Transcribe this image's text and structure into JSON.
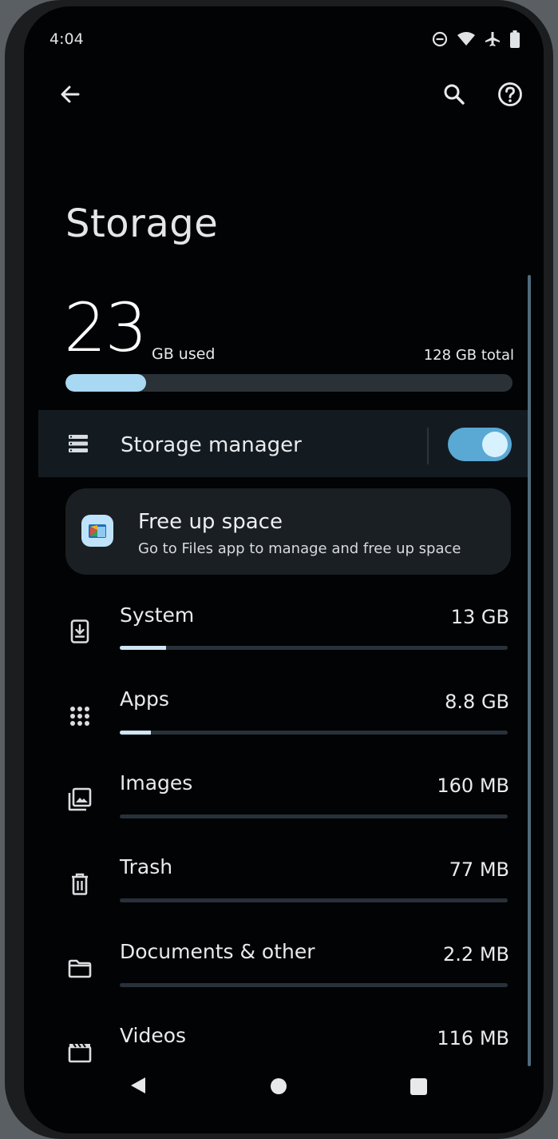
{
  "status_bar": {
    "time": "4:04",
    "icons": [
      "do-not-disturb-icon",
      "wifi-icon",
      "airplane-icon",
      "battery-icon"
    ]
  },
  "app_bar": {
    "back_icon": "arrow-left-icon",
    "actions": [
      "search-icon",
      "help-icon"
    ]
  },
  "page": {
    "title": "Storage"
  },
  "usage": {
    "used_value": "23",
    "used_label": "GB used",
    "total_label": "128 GB total",
    "used_fraction": 0.18
  },
  "storage_manager": {
    "label": "Storage manager",
    "enabled": true,
    "icon": "storage-list-icon"
  },
  "free_up": {
    "title": "Free up space",
    "subtitle": "Go to Files app to manage and free up space",
    "icon": "files-app-icon"
  },
  "categories": [
    {
      "name": "System",
      "size": "13 GB",
      "fraction": 0.12,
      "icon": "system-update-icon"
    },
    {
      "name": "Apps",
      "size": "8.8 GB",
      "fraction": 0.08,
      "icon": "apps-grid-icon"
    },
    {
      "name": "Images",
      "size": "160 MB",
      "fraction": 0.0,
      "icon": "image-gallery-icon"
    },
    {
      "name": "Trash",
      "size": "77 MB",
      "fraction": 0.0,
      "icon": "trash-icon"
    },
    {
      "name": "Documents & other",
      "size": "2.2 MB",
      "fraction": 0.0,
      "icon": "folder-icon"
    },
    {
      "name": "Videos",
      "size": "116 MB",
      "fraction": 0.0,
      "icon": "video-clapper-icon"
    }
  ],
  "navigation_bar": [
    "back-triangle-icon",
    "home-circle-icon",
    "recents-square-icon"
  ],
  "colors": {
    "accent": "#a9d8f2",
    "toggle_track": "#5aa9d4",
    "background": "#020304"
  }
}
